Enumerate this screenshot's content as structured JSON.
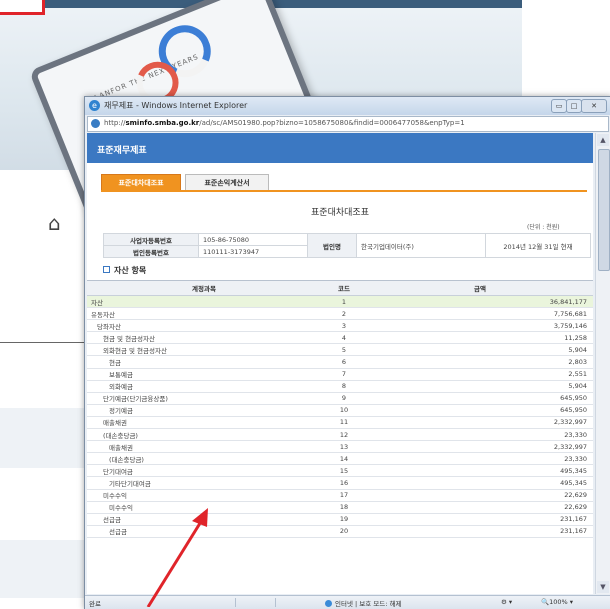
{
  "window": {
    "title": "재무제표 - Windows Internet Explorer",
    "address": "http://sminfo.smba.go.kr/ad/sc/AMS01980.pop?bizno=1058675080&findid=0006477058&enpTyp=1",
    "buttons": {
      "minimize": "▭",
      "maximize": "□",
      "close": "✕"
    }
  },
  "page": {
    "header": "표준재무제표",
    "tabs": [
      "표준대차대조표",
      "표준손익계산서"
    ],
    "active_tab": 0,
    "title": "표준대차대조표",
    "unit": "(단위 : 천원)",
    "info": {
      "bizno_label": "사업자등록번호",
      "bizno": "105-86-75080",
      "corpno_label": "법인등록번호",
      "corpno": "110111-3173947",
      "corp_label": "법인명",
      "corp": "한국기업데이터(주)",
      "date": "2014년 12월 31일 현재"
    },
    "section": "자산 항목",
    "columns": [
      "계정과목",
      "코드",
      "금액"
    ]
  },
  "rows": [
    {
      "name": "자산",
      "code": "1",
      "amount": "36,841,177",
      "hl": true,
      "indent": 0
    },
    {
      "name": "유동자산",
      "code": "2",
      "amount": "7,756,681",
      "hl": false,
      "indent": 0
    },
    {
      "name": "당좌자산",
      "code": "3",
      "amount": "3,759,146",
      "hl": false,
      "indent": 1
    },
    {
      "name": "현금 및 현금성자산",
      "code": "4",
      "amount": "11,258",
      "hl": false,
      "indent": 2
    },
    {
      "name": "외화현금 및 현금성자산",
      "code": "5",
      "amount": "5,904",
      "hl": false,
      "indent": 2
    },
    {
      "name": "현금",
      "code": "6",
      "amount": "2,803",
      "hl": false,
      "indent": 3
    },
    {
      "name": "보통예금",
      "code": "7",
      "amount": "2,551",
      "hl": false,
      "indent": 3
    },
    {
      "name": "외화예금",
      "code": "8",
      "amount": "5,904",
      "hl": false,
      "indent": 3
    },
    {
      "name": "단기예금(단기금융상품)",
      "code": "9",
      "amount": "645,950",
      "hl": false,
      "indent": 2
    },
    {
      "name": "정기예금",
      "code": "10",
      "amount": "645,950",
      "hl": false,
      "indent": 3
    },
    {
      "name": "매출채권",
      "code": "11",
      "amount": "2,332,997",
      "hl": false,
      "indent": 2
    },
    {
      "name": "(대손충당금)",
      "code": "12",
      "amount": "23,330",
      "hl": false,
      "indent": 2
    },
    {
      "name": "매출채권",
      "code": "13",
      "amount": "2,332,997",
      "hl": false,
      "indent": 3
    },
    {
      "name": "(대손충당금)",
      "code": "14",
      "amount": "23,330",
      "hl": false,
      "indent": 3
    },
    {
      "name": "단기대여금",
      "code": "15",
      "amount": "495,345",
      "hl": false,
      "indent": 2
    },
    {
      "name": "기타단기대여금",
      "code": "16",
      "amount": "495,345",
      "hl": false,
      "indent": 3
    },
    {
      "name": "미수수익",
      "code": "17",
      "amount": "22,629",
      "hl": false,
      "indent": 2
    },
    {
      "name": "미수수익",
      "code": "18",
      "amount": "22,629",
      "hl": false,
      "indent": 3
    },
    {
      "name": "선급금",
      "code": "19",
      "amount": "231,167",
      "hl": false,
      "indent": 2
    },
    {
      "name": "선급금",
      "code": "20",
      "amount": "231,167",
      "hl": false,
      "indent": 3
    }
  ],
  "status": {
    "left": "완료",
    "zone": "인터넷 | 보호 모드: 해제",
    "tools": "⚙ ▾",
    "zoom": "🔍100% ▾"
  },
  "background": {
    "tablet_text": "PLANFOR THE NEXT YEARS"
  },
  "colors": {
    "accent": "#3b78c2",
    "tab_active": "#f09320",
    "highlight_row": "#eaf5dc",
    "arrow": "#e0242a"
  }
}
